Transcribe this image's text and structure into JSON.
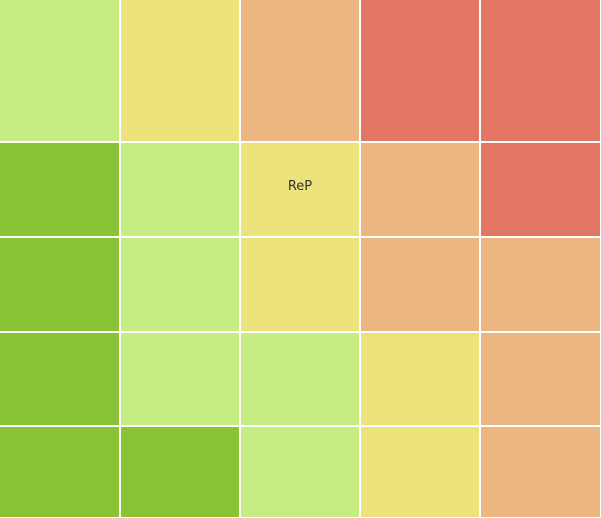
{
  "chart_data": {
    "type": "heatmap",
    "rows": 5,
    "cols": 5,
    "levels": [
      [
        2,
        3,
        4,
        5,
        5
      ],
      [
        1,
        2,
        3,
        4,
        5
      ],
      [
        1,
        2,
        3,
        4,
        4
      ],
      [
        1,
        2,
        2,
        3,
        4
      ],
      [
        1,
        1,
        2,
        3,
        4
      ]
    ],
    "annotations": [
      {
        "row": 1,
        "col": 2,
        "text": "ReP"
      }
    ]
  },
  "palette": {
    "1": "#8ac336",
    "2": "#c5ed82",
    "3": "#ede37c",
    "4": "#edb582",
    "5": "#e37664"
  }
}
